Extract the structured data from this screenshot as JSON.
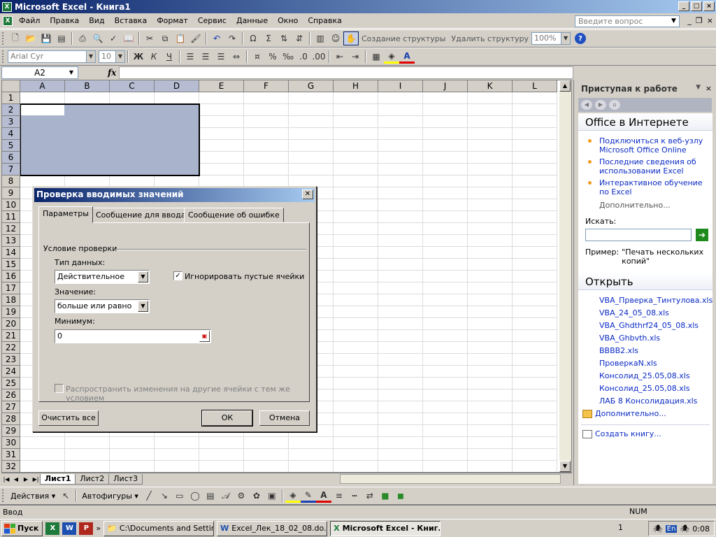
{
  "window": {
    "title": "Microsoft Excel - Книга1",
    "min": "_",
    "max": "□",
    "close": "×"
  },
  "menu": {
    "items": [
      "Файл",
      "Правка",
      "Вид",
      "Вставка",
      "Формат",
      "Сервис",
      "Данные",
      "Окно",
      "Справка"
    ],
    "help_placeholder": "Введите вопрос"
  },
  "toolbar_std": {
    "create_structure": "Создание структуры",
    "delete_structure": "Удалить структуру",
    "zoom": "100%"
  },
  "toolbar_fmt": {
    "font": "Arial Cyr",
    "size": "10",
    "bold": "Ж",
    "italic": "К",
    "underline": "Ч",
    "percent": "%"
  },
  "formula_bar": {
    "name_box": "A2",
    "fx": "fx",
    "content": ""
  },
  "sheet": {
    "columns": [
      "A",
      "B",
      "C",
      "D",
      "E",
      "F",
      "G",
      "H",
      "I",
      "J",
      "K",
      "L"
    ],
    "rows": [
      "1",
      "2",
      "3",
      "4",
      "5",
      "6",
      "7",
      "8",
      "9",
      "10",
      "11",
      "12",
      "13",
      "14",
      "15",
      "16",
      "17",
      "18",
      "19",
      "20",
      "21",
      "22",
      "23",
      "24",
      "25",
      "26",
      "27",
      "28",
      "29",
      "30",
      "31",
      "32"
    ],
    "selected_range": "A2:D7",
    "tabs": [
      "Лист1",
      "Лист2",
      "Лист3"
    ],
    "active_tab": "Лист1"
  },
  "draw_toolbar": {
    "actions": "Действия",
    "autoshapes": "Автофигуры"
  },
  "status": {
    "text": "Ввод",
    "num": "NUM"
  },
  "dialog": {
    "title": "Проверка вводимых значений",
    "tabs": [
      "Параметры",
      "Сообщение для ввода",
      "Сообщение об ошибке"
    ],
    "active_tab": "Параметры",
    "group_title": "Условие проверки",
    "data_type_label": "Тип данных:",
    "data_type_value": "Действительное",
    "ignore_blank_label": "Игнорировать пустые ячейки",
    "ignore_blank_checked": true,
    "operator_label": "Значение:",
    "operator_value": "больше или равно",
    "minimum_label": "Минимум:",
    "minimum_value": "0",
    "apply_all_label": "Распространить изменения на другие ячейки с тем же условием",
    "clear_all": "Очистить все",
    "ok": "ОК",
    "cancel": "Отмена"
  },
  "task_pane": {
    "title": "Приступая к работе",
    "office_online_heading": "Office в Интернете",
    "online_links": [
      "Подключиться к веб-узлу Microsoft Office Online",
      "Последние сведения об использовании Excel",
      "Интерактивное обучение по Excel"
    ],
    "more_online": "Дополнительно...",
    "search_label": "Искать:",
    "example_label": "Пример:",
    "example_value": "\"Печать нескольких копий\"",
    "open_heading": "Открыть",
    "files": [
      "VBA_Прверка_Тинтулова.xls",
      "VBA_24_05_08.xls",
      "VBA_Ghdthrf24_05_08.xls",
      "VBA_Ghbvth.xls",
      "ВВВВ2.xls",
      "ПроверкаN.xls",
      "Консолид_25.05,08.xls",
      "Консолид_25.05,08.xls",
      "ЛАБ 8 Консолидация.xls"
    ],
    "more_files": "Дополнительно...",
    "create_book": "Создать книгу..."
  },
  "taskbar": {
    "start": "Пуск",
    "buttons": [
      "C:\\Documents and Settin...",
      "Excel_Лек_18_02_08.do...",
      "Microsoft Excel - Книг..."
    ],
    "active_button": 2,
    "tray_num": "1",
    "lang": "En",
    "clock": "0:08"
  }
}
